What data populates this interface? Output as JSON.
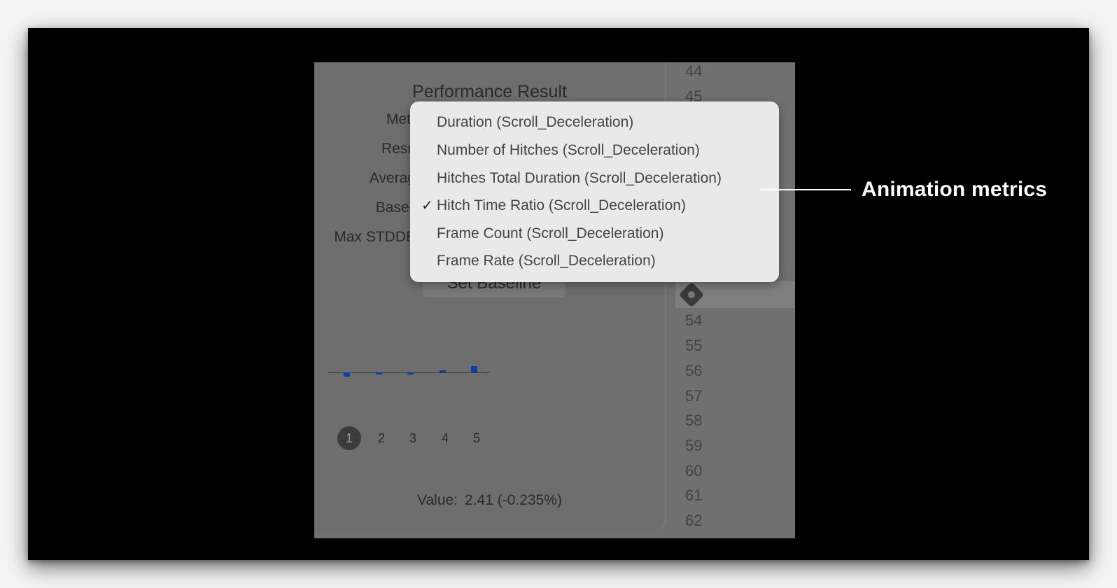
{
  "popover": {
    "title": "Performance Result",
    "labels": [
      "Metr",
      "Resu",
      "Averag",
      "Baseli",
      "Max STDDE"
    ],
    "set_baseline_label": "Set Baseline",
    "value_label": "Value:",
    "value_text": "2.41 (-0.235%)",
    "pages": [
      "1",
      "2",
      "3",
      "4",
      "5"
    ],
    "active_page": "1",
    "bar_colour": "#0b3fa6"
  },
  "chart_data": {
    "type": "bar",
    "categories": [
      "1",
      "2",
      "3",
      "4",
      "5"
    ],
    "values": [
      -0.3,
      -0.15,
      -0.15,
      0.1,
      0.45
    ],
    "ylim": [
      -1,
      1
    ]
  },
  "gutter_lines": [
    "44",
    "45",
    "54",
    "55",
    "56",
    "57",
    "58",
    "59",
    "60",
    "61",
    "62"
  ],
  "menu": {
    "items": [
      {
        "label": "Duration (Scroll_Deceleration)",
        "checked": false
      },
      {
        "label": "Number of Hitches (Scroll_Deceleration)",
        "checked": false
      },
      {
        "label": "Hitches Total Duration (Scroll_Deceleration)",
        "checked": false
      },
      {
        "label": "Hitch Time Ratio (Scroll_Deceleration)",
        "checked": true
      },
      {
        "label": "Frame Count (Scroll_Deceleration)",
        "checked": false
      },
      {
        "label": "Frame Rate (Scroll_Deceleration)",
        "checked": false
      }
    ],
    "check_glyph": "✓"
  },
  "callout": {
    "text": "Animation metrics"
  }
}
